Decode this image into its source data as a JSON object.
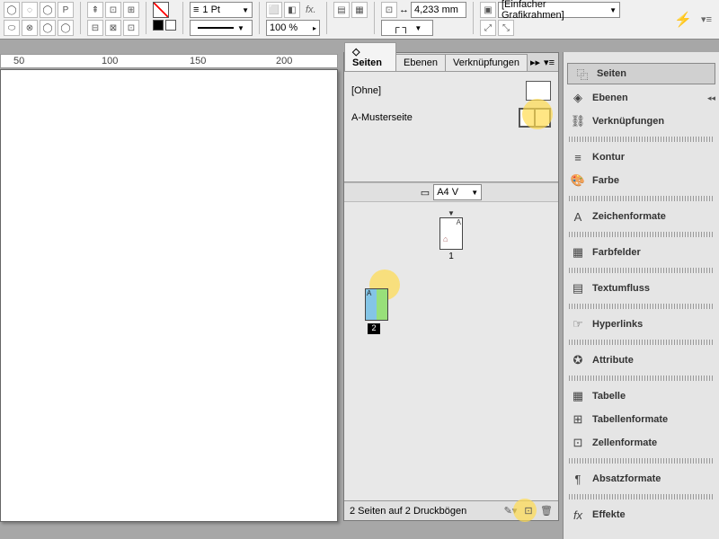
{
  "toolbar": {
    "stroke_weight": "1 Pt",
    "zoom": "100 %",
    "dim_value": "4,233 mm",
    "frame_type": "[Einfacher Grafikrahmen]"
  },
  "ruler": {
    "t50": "50",
    "t100": "100",
    "t150": "150",
    "t200": "200"
  },
  "pages_panel": {
    "tabs": {
      "seiten": "Seiten",
      "ebenen": "Ebenen",
      "verkn": "Verknüpfungen"
    },
    "masters": {
      "none": "[Ohne]",
      "a": "A-Musterseite"
    },
    "page_size": "A4 V",
    "page1": "1",
    "page2": "2",
    "footer": "2 Seiten auf 2 Druckbögen"
  },
  "sidebar": {
    "seiten": "Seiten",
    "ebenen": "Ebenen",
    "verkn": "Verknüpfungen",
    "kontur": "Kontur",
    "farbe": "Farbe",
    "zeichen": "Zeichenformate",
    "farbfelder": "Farbfelder",
    "textumfluss": "Textumfluss",
    "hyperlinks": "Hyperlinks",
    "attribute": "Attribute",
    "tabelle": "Tabelle",
    "tabellenformate": "Tabellenformate",
    "zellenformate": "Zellenformate",
    "absatz": "Absatzformate",
    "effekte": "Effekte"
  }
}
